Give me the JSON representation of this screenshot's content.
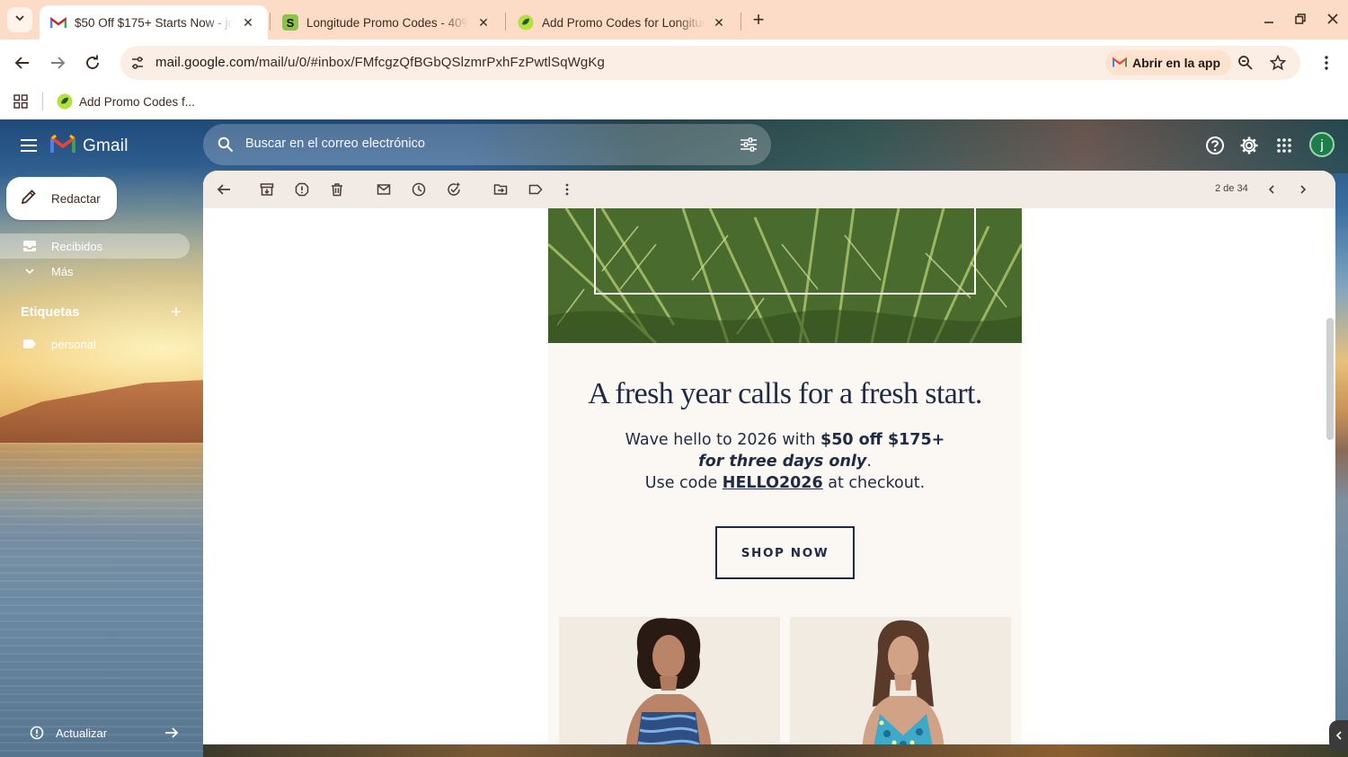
{
  "browser": {
    "tabs": [
      {
        "title": "$50 Off $175+ Starts Now - jos",
        "favicon": "gmail-icon",
        "active": true
      },
      {
        "title": "Longitude Promo Codes - 40%",
        "favicon": "s-logo-icon",
        "active": false
      },
      {
        "title": "Add Promo Codes for Longitude",
        "favicon": "promo-leaf-icon",
        "active": false
      }
    ],
    "address": {
      "host": "mail.google.com",
      "path": "/mail/u/0/#inbox/FMfcgzQfBGbQSlzmrPxhFzPwtlSqWgKg"
    },
    "open_in_app_label": "Abrir en la app",
    "bookmarks": [
      {
        "label": "Add Promo Codes f...",
        "favicon": "promo-leaf-icon"
      }
    ],
    "accent": "#fcdcc6"
  },
  "gmail": {
    "wordmark": "Gmail",
    "search_placeholder": "Buscar en el correo electrónico",
    "compose_label": "Redactar",
    "nav": [
      {
        "label": "Recibidos",
        "icon": "inbox-icon",
        "active": true
      },
      {
        "label": "Más",
        "icon": "chevron-down-icon",
        "active": false
      }
    ],
    "labels_header": "Etiquetas",
    "labels": [
      {
        "label": "personal",
        "icon": "label-icon"
      }
    ],
    "update_label": "Actualizar",
    "avatar_letter": "j",
    "pager_text": "2 de 34"
  },
  "email": {
    "headline": "A fresh year calls for a fresh start.",
    "line1_prefix": "Wave hello to 2026 with ",
    "line1_offer": "$50 off $175+",
    "line2": "for three days only",
    "line2_suffix": ".",
    "line3_prefix": "Use code ",
    "code": "HELLO2026",
    "line3_suffix": " at checkout.",
    "cta": "SHOP NOW",
    "text_color": "#1f2a44"
  }
}
